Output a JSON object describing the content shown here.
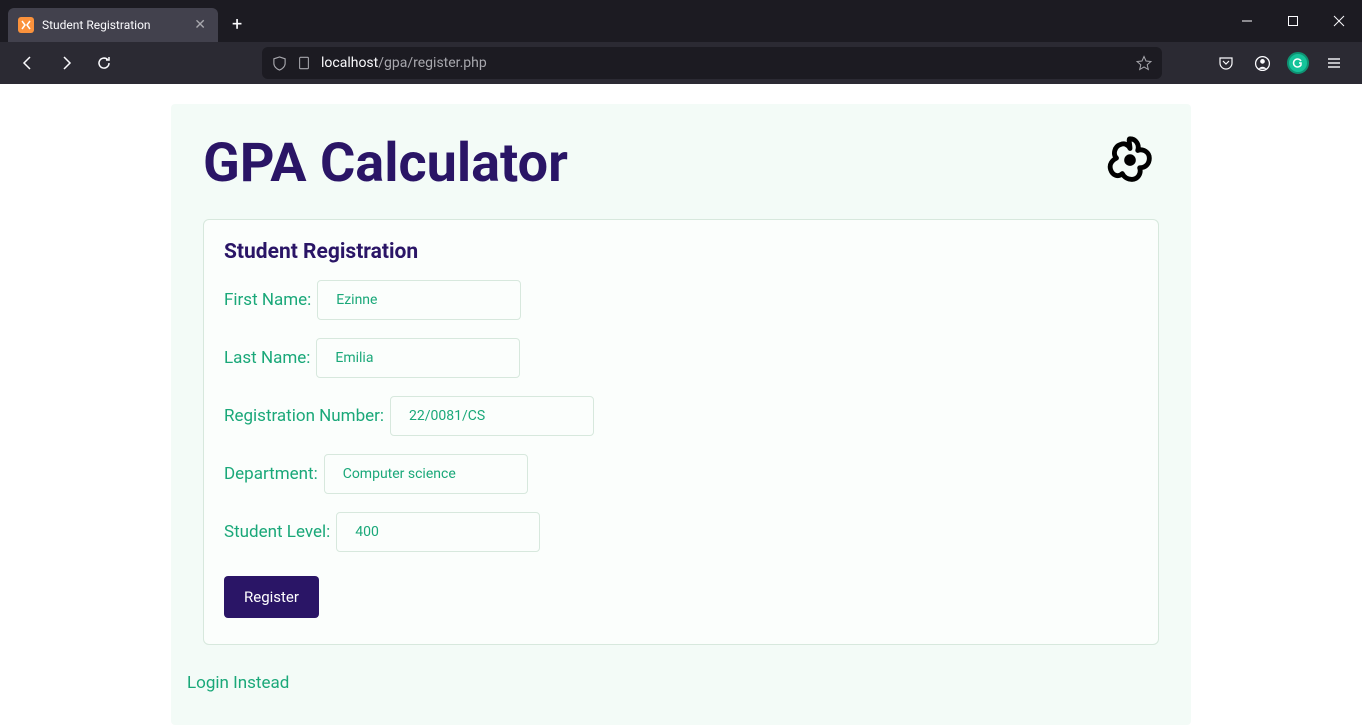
{
  "browser": {
    "tab_title": "Student Registration",
    "url_host": "localhost",
    "url_path": "/gpa/register.php"
  },
  "page": {
    "title": "GPA Calculator",
    "login_link": "Login Instead"
  },
  "form": {
    "title": "Student Registration",
    "first_name": {
      "label": "First Name:",
      "value": "Ezinne"
    },
    "last_name": {
      "label": "Last Name:",
      "value": "Emilia"
    },
    "reg_number": {
      "label": "Registration Number:",
      "value": "22/0081/CS"
    },
    "department": {
      "label": "Department:",
      "value": "Computer science"
    },
    "level": {
      "label": "Student Level:",
      "value": "400"
    },
    "submit_label": "Register"
  }
}
